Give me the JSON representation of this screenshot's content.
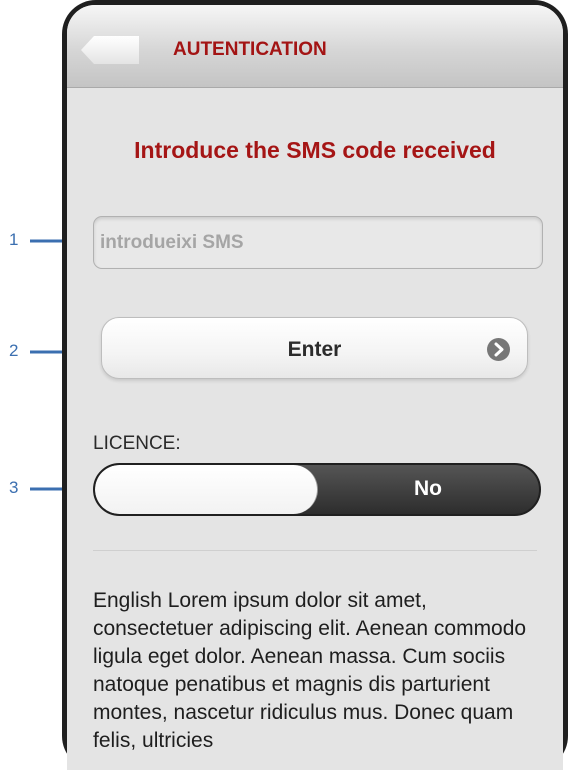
{
  "annotations": [
    "1",
    "2",
    "3"
  ],
  "navbar": {
    "title": "AUTENTICATION",
    "back_icon": "back-arrow-button"
  },
  "heading": "Introduce the SMS code received",
  "sms_input": {
    "placeholder": "introdueixi SMS",
    "value": ""
  },
  "enter_button": {
    "label": "Enter",
    "icon": "chevron-right-circle-icon"
  },
  "licence": {
    "label": "LICENCE:",
    "toggle_state": "No"
  },
  "body_text": "English Lorem ipsum dolor sit amet, consectetuer adipiscing elit. Aenean commodo ligula eget dolor. Aenean massa. Cum sociis natoque penatibus et magnis dis parturient montes, nascetur ridiculus mus. Donec quam felis, ultricies",
  "colors": {
    "accent_red": "#a51515",
    "annotation_blue": "#3b6fb0",
    "phone_frame": "#1f1f1f",
    "toggle_dark": "#2d2d2d"
  }
}
